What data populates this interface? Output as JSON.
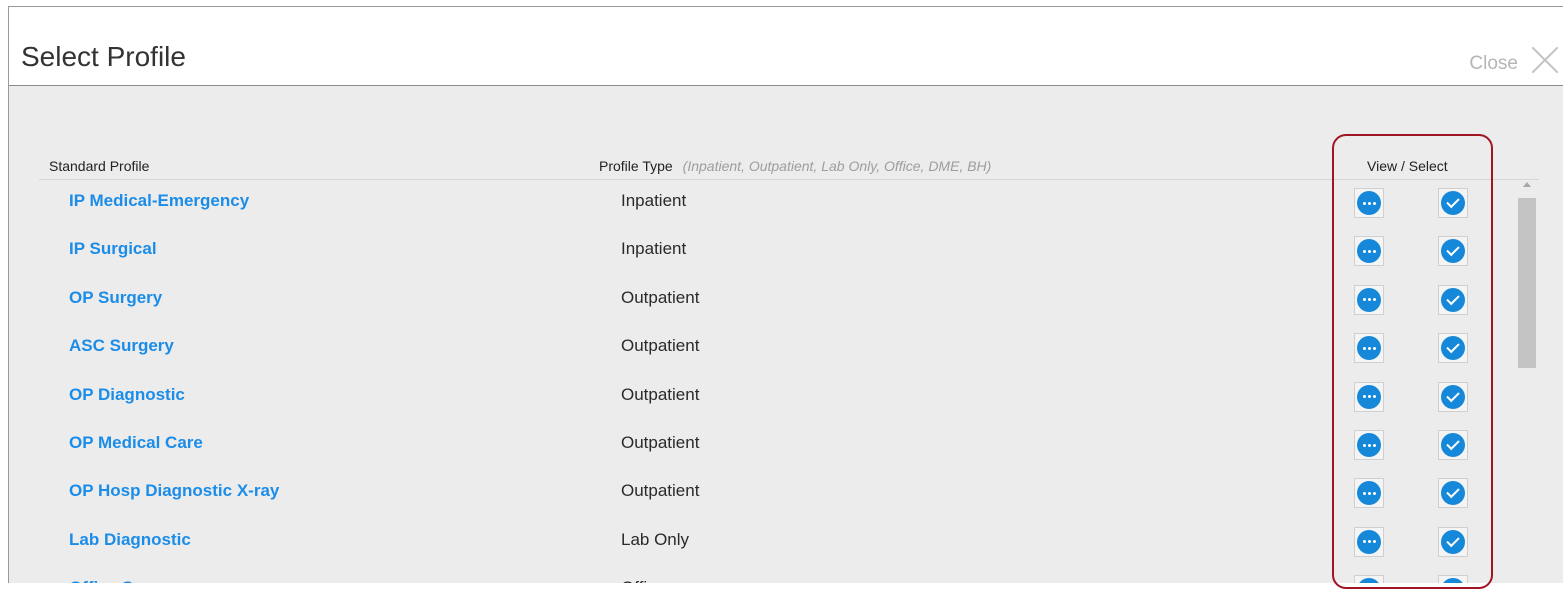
{
  "dialog": {
    "title": "Select Profile",
    "close_label": "Close"
  },
  "columns": {
    "standard_profile": "Standard Profile",
    "profile_type": "Profile Type",
    "profile_type_hint": "(Inpatient, Outpatient, Lab Only, Office, DME, BH)",
    "view_select": "View / Select"
  },
  "rows": [
    {
      "name": "IP Medical-Emergency",
      "type": "Inpatient"
    },
    {
      "name": "IP Surgical",
      "type": "Inpatient"
    },
    {
      "name": "OP Surgery",
      "type": "Outpatient"
    },
    {
      "name": "ASC Surgery",
      "type": "Outpatient"
    },
    {
      "name": "OP Diagnostic",
      "type": "Outpatient"
    },
    {
      "name": "OP Medical Care",
      "type": "Outpatient"
    },
    {
      "name": "OP Hosp Diagnostic X-ray",
      "type": "Outpatient"
    },
    {
      "name": "Lab Diagnostic",
      "type": "Lab Only"
    },
    {
      "name": "Office Surgery",
      "type": "Office"
    }
  ],
  "icons": {
    "view": "view-more-icon",
    "select": "select-check-icon",
    "close": "close-x-icon"
  },
  "colors": {
    "link": "#1b8de8",
    "icon_fill": "#1588d9",
    "highlight_border": "#a01523",
    "body_background": "#ececec"
  }
}
